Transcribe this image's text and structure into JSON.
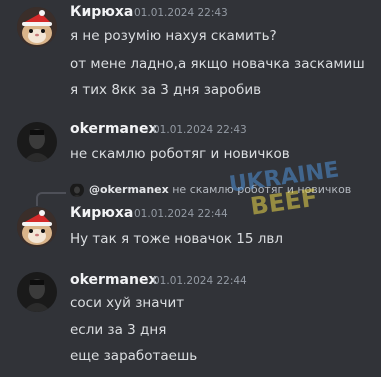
{
  "messages": [
    {
      "author": "Кирюха",
      "timestamp": "01.01.2024 22:43",
      "lines": [
        "я не розумію нахуя скамить?",
        "от мене ладно,а якщо новачка заскамиш",
        "я тих 8кк за 3 дня заробив"
      ],
      "avatar_icon": "hamster-with-santa-hat-icon"
    },
    {
      "author": "okermanex",
      "timestamp": "01.01.2024 22:43",
      "lines": [
        "не скамлю роботяг и новичков"
      ],
      "avatar_icon": "dark-portrait-icon"
    },
    {
      "author": "Кирюха",
      "timestamp": "01.01.2024 22:44",
      "reply": {
        "author": "@okermanex",
        "text": "не скамлю роботяг и новичков"
      },
      "lines": [
        "Ну так я тоже новачок 15 лвл"
      ],
      "avatar_icon": "hamster-with-santa-hat-icon"
    },
    {
      "author": "okermanex",
      "timestamp": "01.01.2024 22:44",
      "lines": [
        "соси хуй значит",
        "если за 3 дня",
        "еще заработаешь"
      ],
      "avatar_icon": "dark-portrait-icon"
    }
  ],
  "watermark": {
    "top": "UKRAINE",
    "bottom": "BEEF"
  },
  "colors": {
    "background": "#313338",
    "author_name": "#f2f3f5",
    "timestamp": "#949ba4",
    "message_text": "#dbdee1",
    "watermark_blue": "#4f8fd6",
    "watermark_yellow": "#e9d64a"
  }
}
